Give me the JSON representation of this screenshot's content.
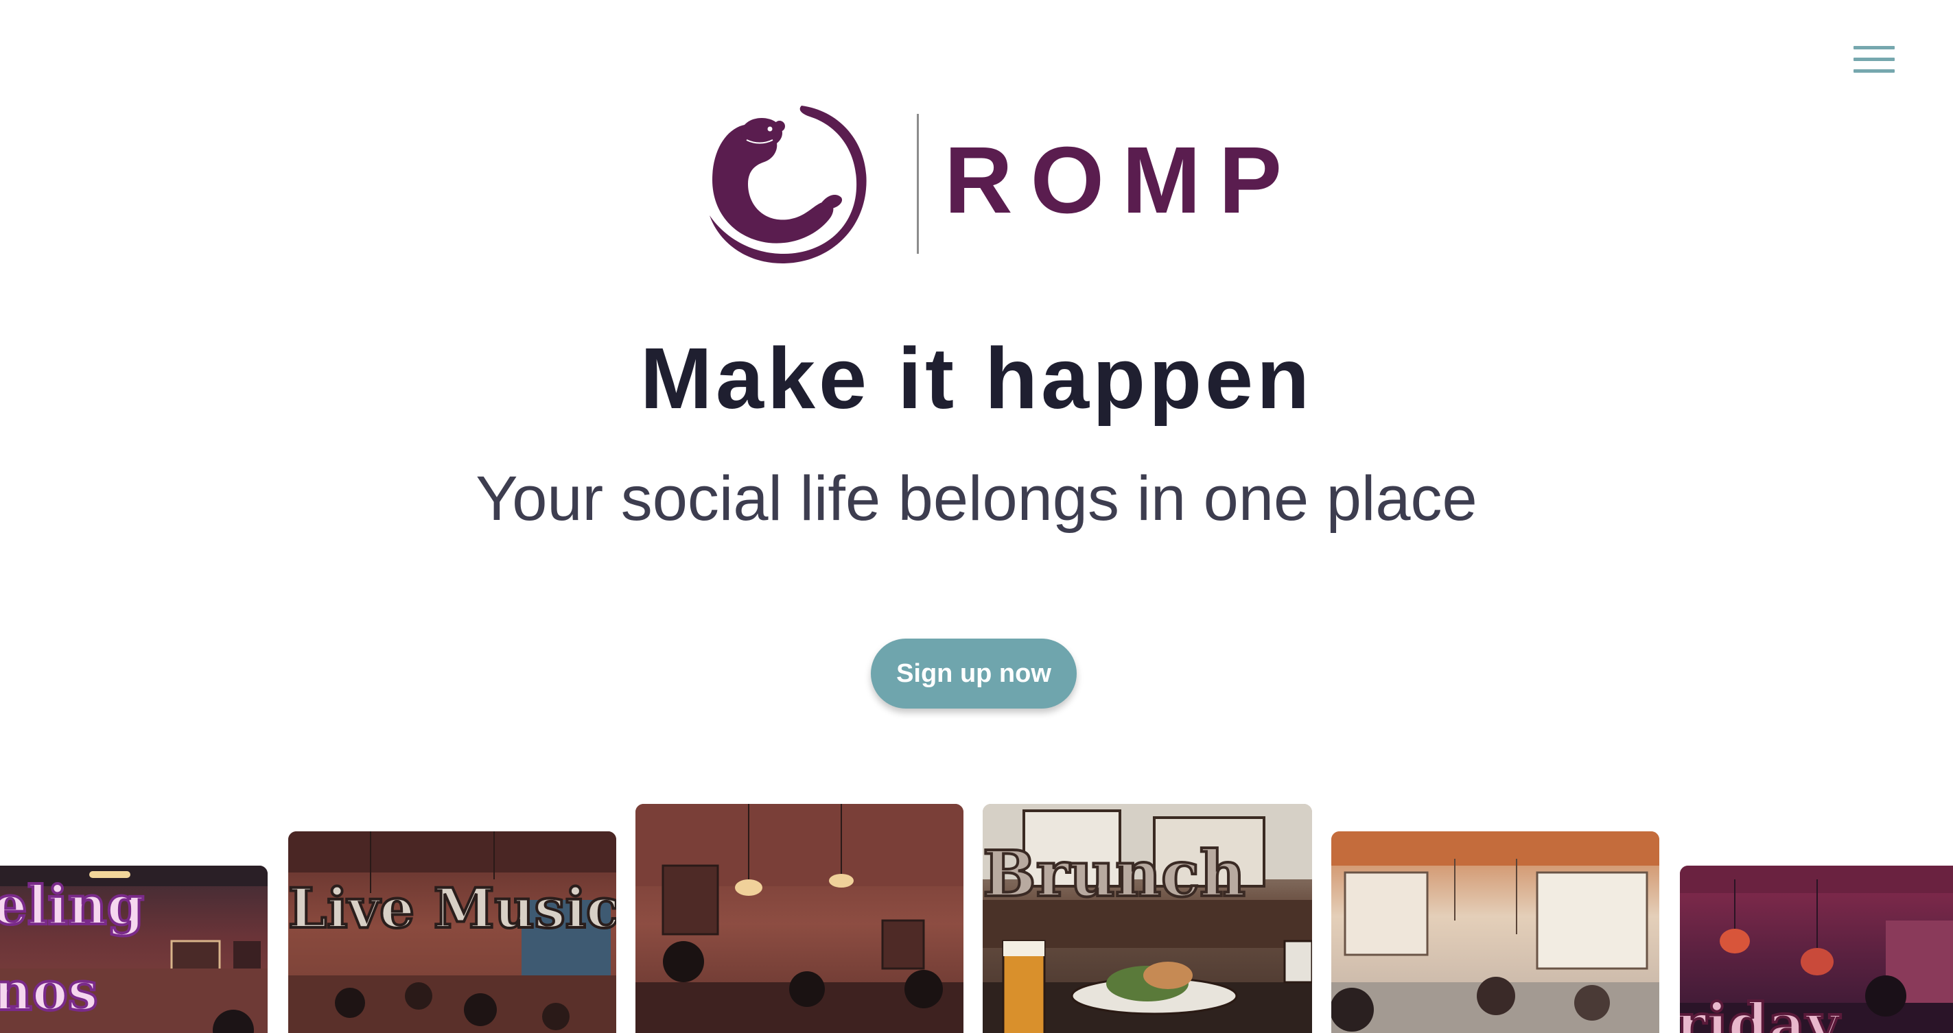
{
  "header": {
    "menu_icon": "hamburger-menu-icon",
    "menu_color": "#76a7ae"
  },
  "logo": {
    "mark_icon": "otter-logo-icon",
    "wordmark": "ROMP",
    "brand_color": "#5a1d4f"
  },
  "hero": {
    "headline": "Make it happen",
    "subheadline": "Your social life belongs in one place",
    "cta_label": "Sign up now",
    "cta_color": "#6fa5ad"
  },
  "carousel": {
    "cards": [
      {
        "name": "event-card-dueling-pianos",
        "title_lines": [
          "eling",
          "nos"
        ],
        "scene": "piano bar interior"
      },
      {
        "name": "event-card-live-music",
        "title_lines": [
          "Live Music"
        ],
        "scene": "bar with live band"
      },
      {
        "name": "event-card-band",
        "title_lines": [],
        "scene": "singer with guitarists"
      },
      {
        "name": "event-card-brunch",
        "title_lines": [
          "Brunch"
        ],
        "scene": "brunch table with beer"
      },
      {
        "name": "event-card-cafe",
        "title_lines": [],
        "scene": "bright cafe crowd"
      },
      {
        "name": "event-card-friday",
        "title_lines": [
          "riday"
        ],
        "scene": "lounge with DJ"
      }
    ]
  }
}
